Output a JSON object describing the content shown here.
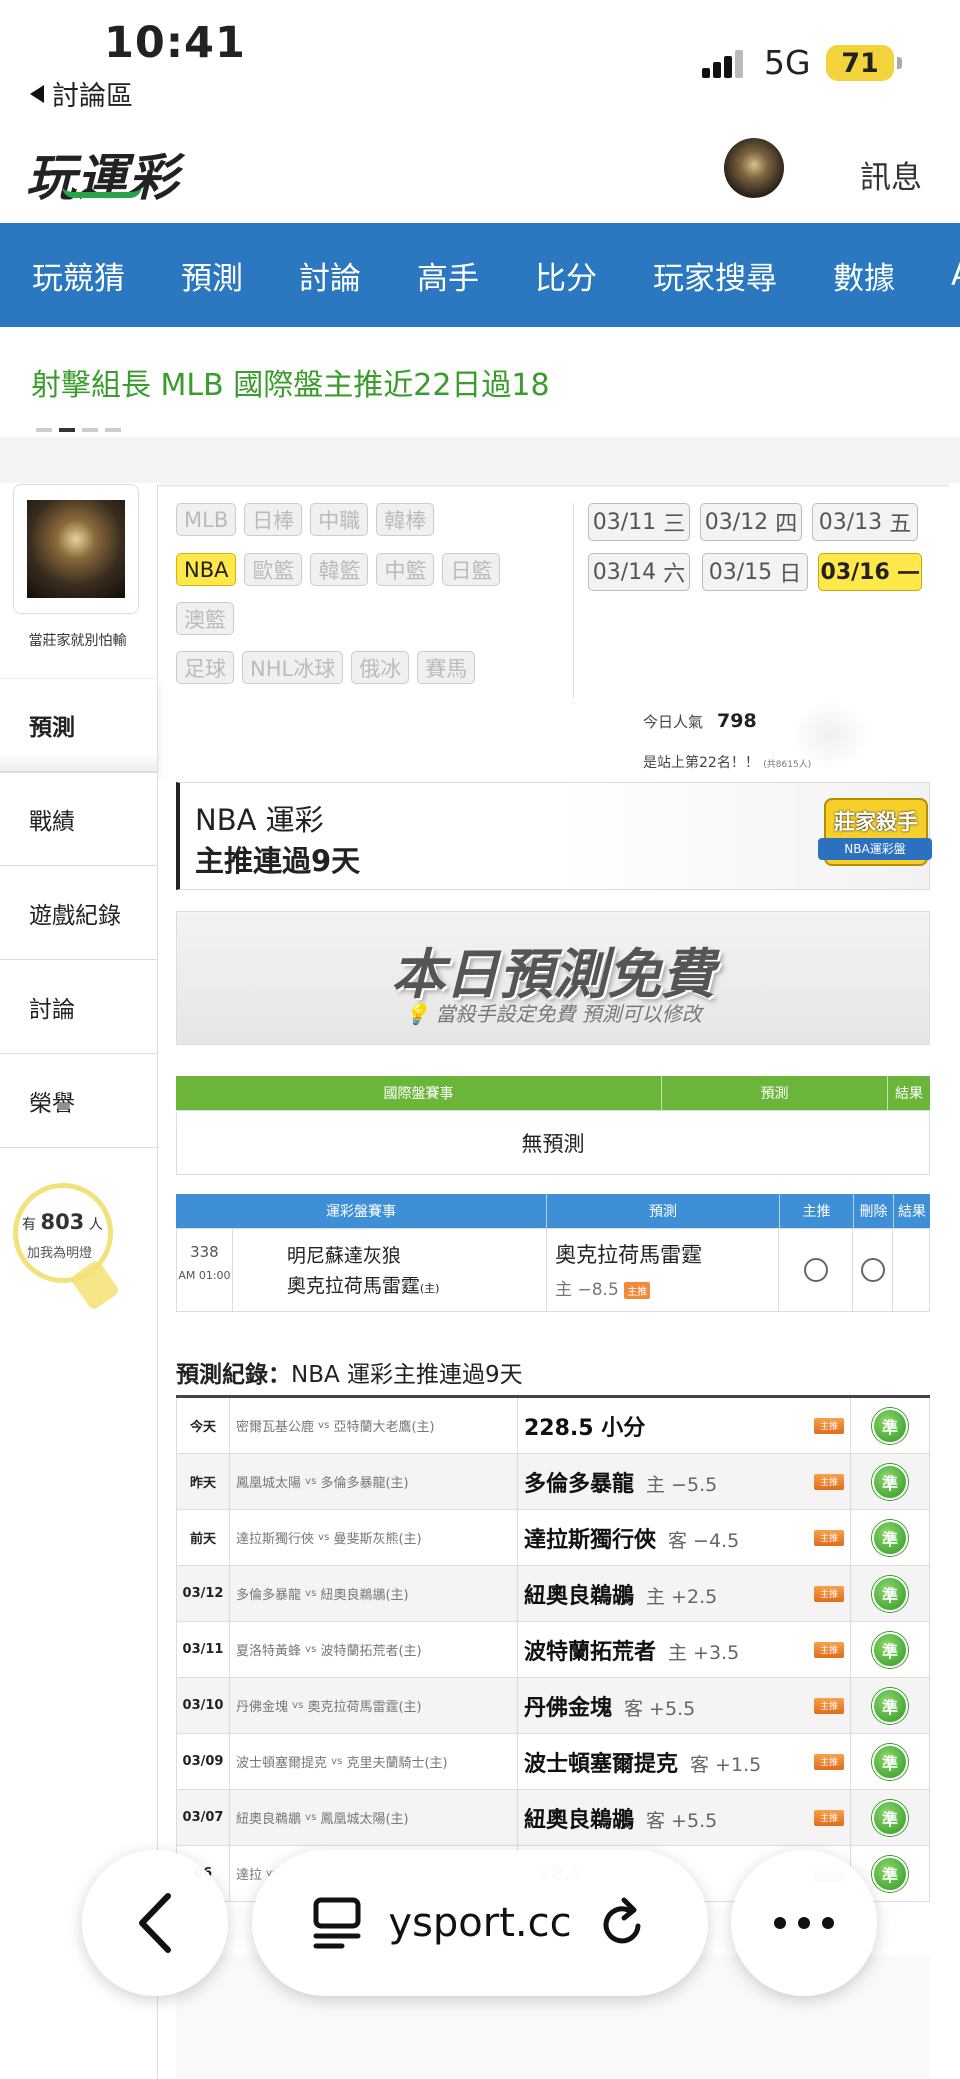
{
  "status": {
    "time": "10:41",
    "back_label": "討論區",
    "network": "5G",
    "battery": "71"
  },
  "header": {
    "logo": "玩運彩",
    "messages": "訊息"
  },
  "nav": [
    "玩競猜",
    "預測",
    "討論",
    "高手",
    "比分",
    "玩家搜尋",
    "數據",
    "AP"
  ],
  "headline": "射擊組長 MLB 國際盤主推近22日過18",
  "profile": {
    "name": "當莊家就別怕輸"
  },
  "left_nav": [
    {
      "label": "預測",
      "active": true
    },
    {
      "label": "戰績",
      "active": false
    },
    {
      "label": "遊戲紀錄",
      "active": false
    },
    {
      "label": "討論",
      "active": false
    },
    {
      "label": "榮譽",
      "active": false
    }
  ],
  "fans": {
    "prefix": "有",
    "count": "803",
    "suffix": "人",
    "sub": "加我為明燈"
  },
  "leagues": {
    "row1": [
      "MLB",
      "日棒",
      "中職",
      "韓棒"
    ],
    "row2": [
      "NBA",
      "歐籃",
      "韓籃",
      "中籃",
      "日籃"
    ],
    "row3": [
      "澳籃"
    ],
    "row4": [
      "足球",
      "NHL冰球",
      "俄冰",
      "賽馬"
    ],
    "selected": "NBA"
  },
  "dates": {
    "row1": [
      {
        "d": "03/11",
        "w": "三"
      },
      {
        "d": "03/12",
        "w": "四"
      },
      {
        "d": "03/13",
        "w": "五"
      }
    ],
    "row2": [
      {
        "d": "03/14",
        "w": "六"
      },
      {
        "d": "03/15",
        "w": "日"
      },
      {
        "d": "03/16",
        "w": "一"
      }
    ],
    "selected": "03/16"
  },
  "popularity": {
    "label": "今日人氣",
    "value": "798",
    "rank": "是站上第22名！！",
    "total": "(共8615人)"
  },
  "nba_banner": {
    "title": "NBA 運彩",
    "streak": "主推連過9天",
    "badge": "莊家殺手",
    "badge_sub": "NBA運彩盤"
  },
  "free_banner": {
    "title": "本日預測免費",
    "sub": "當殺手設定免費 預測可以修改"
  },
  "intl_table": {
    "headers": [
      "國際盤賽事",
      "預測",
      "結果"
    ],
    "empty": "無預測"
  },
  "sport_table": {
    "headers": [
      "運彩盤賽事",
      "預測",
      "主推",
      "刪除",
      "結果"
    ],
    "row": {
      "no": "338",
      "time": "AM 01:00",
      "away": "明尼蘇達灰狼",
      "home": "奧克拉荷馬雷霆",
      "home_tag": "(主)",
      "pick": "奧克拉荷馬雷霆",
      "line": "主 −8.5",
      "tag": "主推"
    }
  },
  "record": {
    "title_bold": "預測紀錄：",
    "title": "NBA 運彩主推連過9天",
    "rows": [
      {
        "day": "今天",
        "away": "密爾瓦基公鹿",
        "home": "亞特蘭大老鷹(主)",
        "pick": "228.5 小分",
        "line": "",
        "tag": "主推",
        "result": "準"
      },
      {
        "day": "昨天",
        "away": "鳳凰城太陽",
        "home": "多倫多暴龍(主)",
        "pick": "多倫多暴龍",
        "line": "主 −5.5",
        "tag": "主推",
        "result": "準"
      },
      {
        "day": "前天",
        "away": "達拉斯獨行俠",
        "home": "曼斐斯灰熊(主)",
        "pick": "達拉斯獨行俠",
        "line": "客 −4.5",
        "tag": "主推",
        "result": "準"
      },
      {
        "day": "03/12",
        "away": "多倫多暴龍",
        "home": "紐奧良鵜鶘(主)",
        "pick": "紐奧良鵜鶘",
        "line": "主 +2.5",
        "tag": "主推",
        "result": "準"
      },
      {
        "day": "03/11",
        "away": "夏洛特黃蜂",
        "home": "波特蘭拓荒者(主)",
        "pick": "波特蘭拓荒者",
        "line": "主 +3.5",
        "tag": "主推",
        "result": "準"
      },
      {
        "day": "03/10",
        "away": "丹佛金塊",
        "home": "奧克拉荷馬雷霆(主)",
        "pick": "丹佛金塊",
        "line": "客 +5.5",
        "tag": "主推",
        "result": "準"
      },
      {
        "day": "03/09",
        "away": "波士頓塞爾提克",
        "home": "克里夫蘭騎士(主)",
        "pick": "波士頓塞爾提克",
        "line": "客 +1.5",
        "tag": "主推",
        "result": "準"
      },
      {
        "day": "03/07",
        "away": "紐奧良鵜鶘",
        "home": "鳳凰城太陽(主)",
        "pick": "紐奧良鵜鶘",
        "line": "客 +5.5",
        "tag": "主推",
        "result": "準"
      },
      {
        "day": "06",
        "away": "達拉",
        "home": "",
        "pick": "",
        "line": "+8.5",
        "tag": "主推",
        "result": "準"
      }
    ],
    "vs": "vs"
  },
  "browser": {
    "url": "ysport.cc"
  }
}
